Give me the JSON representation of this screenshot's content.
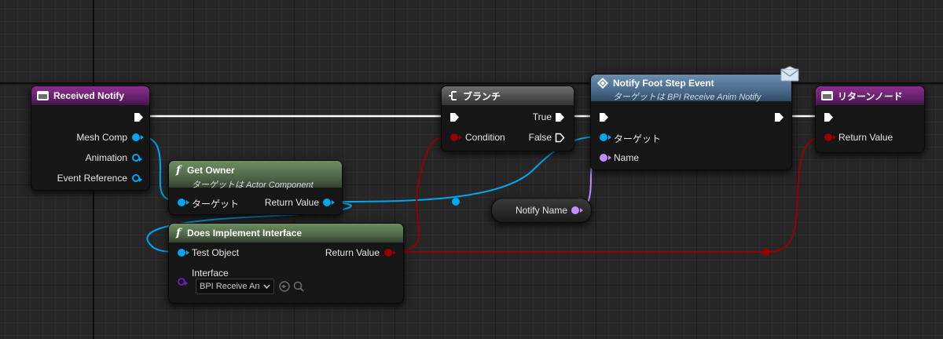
{
  "nodes": {
    "received_notify": {
      "title": "Received Notify",
      "outputs": [
        "Mesh Comp",
        "Animation",
        "Event Reference"
      ]
    },
    "get_owner": {
      "title": "Get Owner",
      "subtitle": "ターゲットは Actor Component",
      "input": "ターゲット",
      "output": "Return Value"
    },
    "does_implement": {
      "title": "Does Implement Interface",
      "input": "Test Object",
      "interface_label": "Interface",
      "interface_value": "BPI Receive An",
      "output": "Return Value"
    },
    "branch": {
      "title": "ブランチ",
      "input": "Condition",
      "out_true": "True",
      "out_false": "False"
    },
    "notify_foot_step": {
      "title": "Notify Foot Step Event",
      "subtitle": "ターゲットは BPI Receive Anim Notify",
      "input_target": "ターゲット",
      "input_name": "Name"
    },
    "notify_name": {
      "label": "Notify Name"
    },
    "return_node": {
      "title": "リターンノード",
      "input": "Return Value"
    }
  },
  "colors": {
    "exec_wire": "#ffffff",
    "object_wire": "#00a6f0",
    "bool_wire": "#960000",
    "name_wire": "#c48bff",
    "event_header": "#5e1f63",
    "function_header": "#4f6647",
    "message_header": "#4a6a8a"
  },
  "icons": {
    "event": "event-icon",
    "function": "function-icon",
    "branch": "branch-icon",
    "message": "message-icon",
    "envelope": "envelope-icon",
    "dropdown_arrow": "chevron-down-icon",
    "use_selected": "use-selected-icon",
    "browse": "search-icon"
  }
}
